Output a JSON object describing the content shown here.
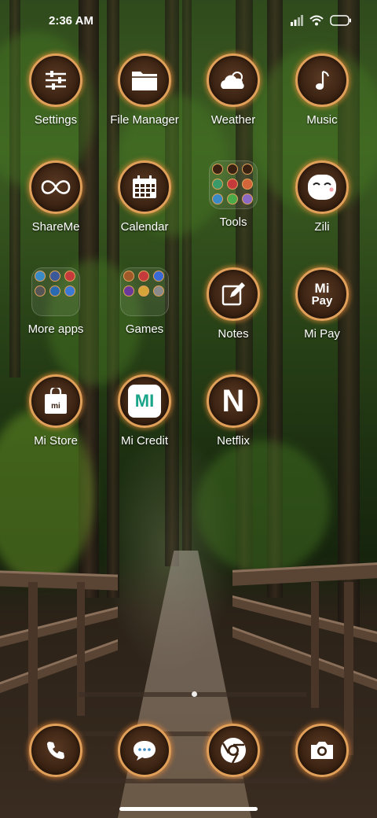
{
  "status_bar": {
    "time": "2:36 AM",
    "icons": [
      "signal-icon",
      "wifi-icon",
      "battery-icon"
    ]
  },
  "apps": [
    {
      "label": "Settings",
      "icon": "sliders-icon"
    },
    {
      "label": "File Manager",
      "icon": "folder-icon"
    },
    {
      "label": "Weather",
      "icon": "cloud-icon"
    },
    {
      "label": "Music",
      "icon": "music-note-icon"
    },
    {
      "label": "ShareMe",
      "icon": "infinity-icon"
    },
    {
      "label": "Calendar",
      "icon": "calendar-icon"
    },
    {
      "label": "Tools",
      "icon": "folder-icon"
    },
    {
      "label": "Zili",
      "icon": "face-icon"
    },
    {
      "label": "More apps",
      "icon": "folder-icon"
    },
    {
      "label": "Games",
      "icon": "folder-icon"
    },
    {
      "label": "Notes",
      "icon": "edit-note-icon"
    },
    {
      "label": "Mi Pay",
      "icon": "mi-pay-icon",
      "glyph_top": "Mi",
      "glyph_bottom": "Pay"
    },
    {
      "label": "Mi Store",
      "icon": "shopping-bag-icon",
      "glyph": "mi"
    },
    {
      "label": "Mi Credit",
      "icon": "mi-credit-icon",
      "glyph": "MI"
    },
    {
      "label": "Netflix",
      "icon": "netflix-icon",
      "glyph": "N"
    }
  ],
  "dock": [
    {
      "icon": "phone-icon"
    },
    {
      "icon": "messages-icon"
    },
    {
      "icon": "chrome-icon"
    },
    {
      "icon": "camera-icon"
    }
  ],
  "colors": {
    "icon_ring": "#e0a05a",
    "icon_fill": "#3a2212",
    "label": "#ffffff"
  }
}
